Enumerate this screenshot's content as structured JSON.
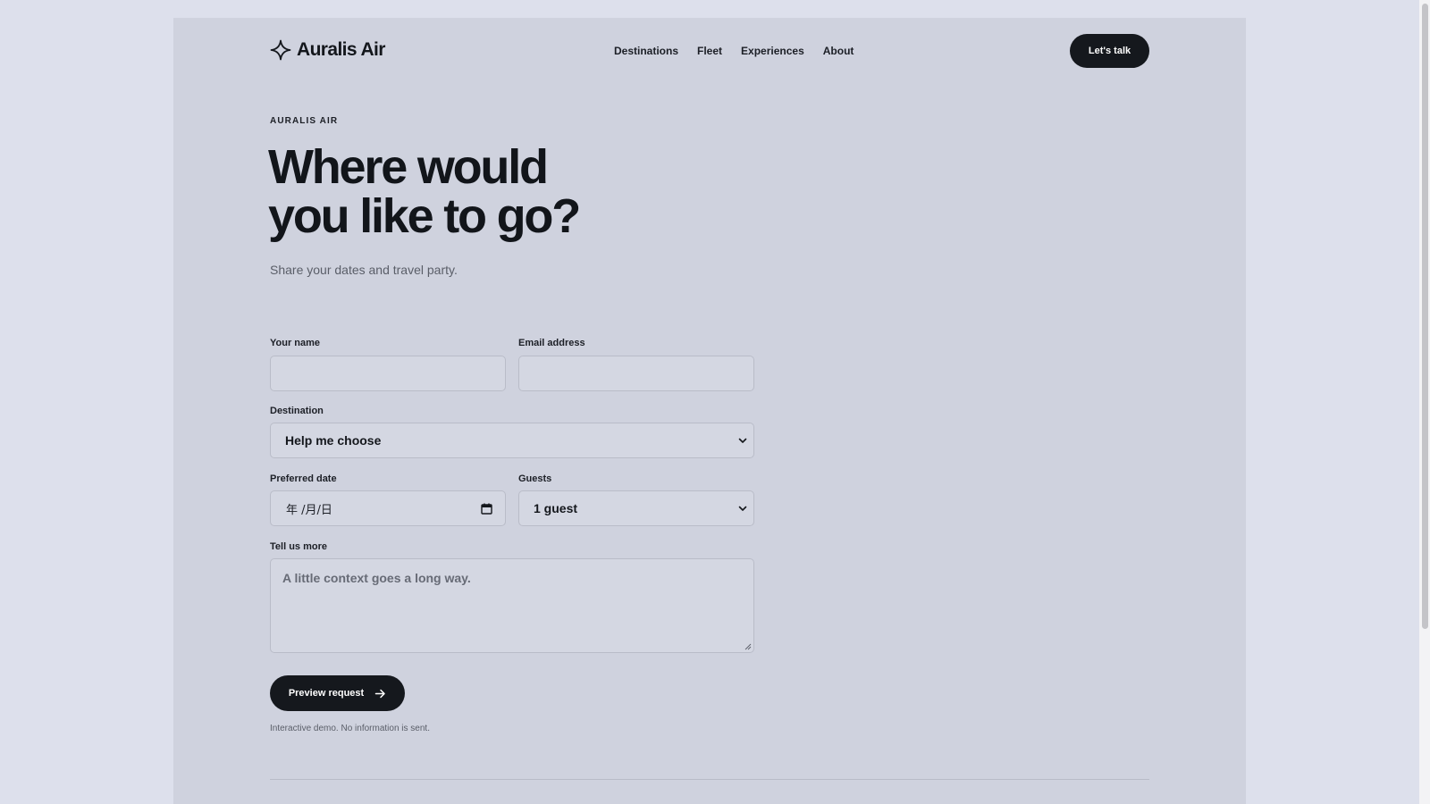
{
  "header": {
    "brand_name": "Auralis Air",
    "nav": [
      "Destinations",
      "Fleet",
      "Experiences",
      "About"
    ],
    "cta_label": "Let's talk"
  },
  "hero": {
    "eyebrow": "AURALIS AIR",
    "headline_line1": "Where would",
    "headline_line2": "you like to go?",
    "subtitle": "Share your dates and travel party."
  },
  "form": {
    "name_label": "Your name",
    "name_value": "",
    "email_label": "Email address",
    "email_value": "",
    "destination_label": "Destination",
    "destination_value": "Help me choose",
    "date_label": "Preferred date",
    "date_value": "年 /月/日",
    "guests_label": "Guests",
    "guests_value": "1 guest",
    "message_label": "Tell us more",
    "message_placeholder": "A little context goes a long way.",
    "submit_label": "Preview request",
    "disclaimer": "Interactive demo. No information is sent."
  },
  "icons": {
    "brand": "sparkle-star-icon",
    "submit": "arrow-right-icon",
    "select": "chevron-down-icon",
    "date": "calendar-icon"
  },
  "colors": {
    "background": "#dde0ec",
    "panel": "#cfd2de",
    "primary_button": "#15181d",
    "text": "#14171c"
  }
}
